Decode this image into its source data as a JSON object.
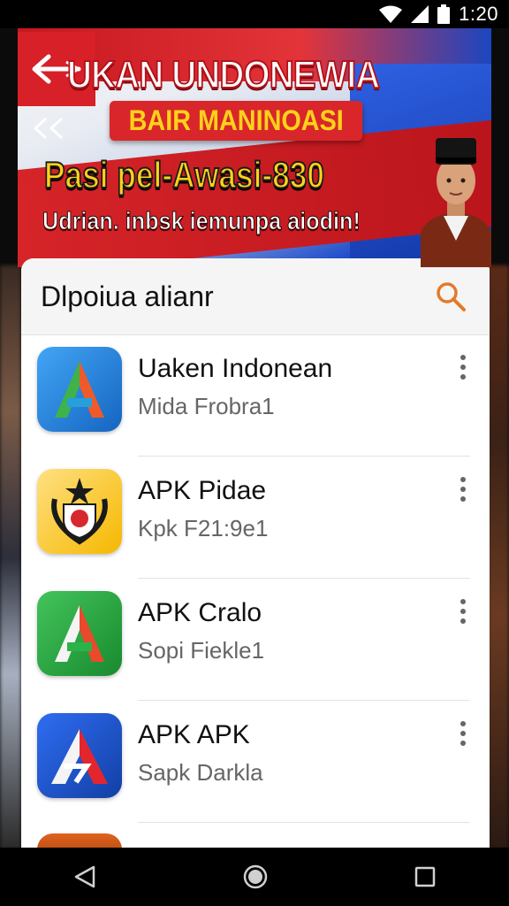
{
  "status": {
    "time": "1:20"
  },
  "banner": {
    "headline": "UKAN UNDONEWIA",
    "pill": "BAIR MANINOASI",
    "subline": "Pasi pel-Awasi-830",
    "tagline": "Udrian. inbsk iemunpa aiodin!"
  },
  "list": {
    "title": "Dlpoiua alianr",
    "items": [
      {
        "name": "Uaken Indonean",
        "sub": "Mida Frobra1"
      },
      {
        "name": "APK Pidae",
        "sub": "Kpk F21:9e1"
      },
      {
        "name": "APK Cralo",
        "sub": "Sopi Fiekle1"
      },
      {
        "name": "APK APK",
        "sub": "Sapk Darkla"
      }
    ]
  },
  "colors": {
    "accent": "#e27a2b",
    "banner_red": "#d72027",
    "banner_blue": "#1e4cc9"
  }
}
